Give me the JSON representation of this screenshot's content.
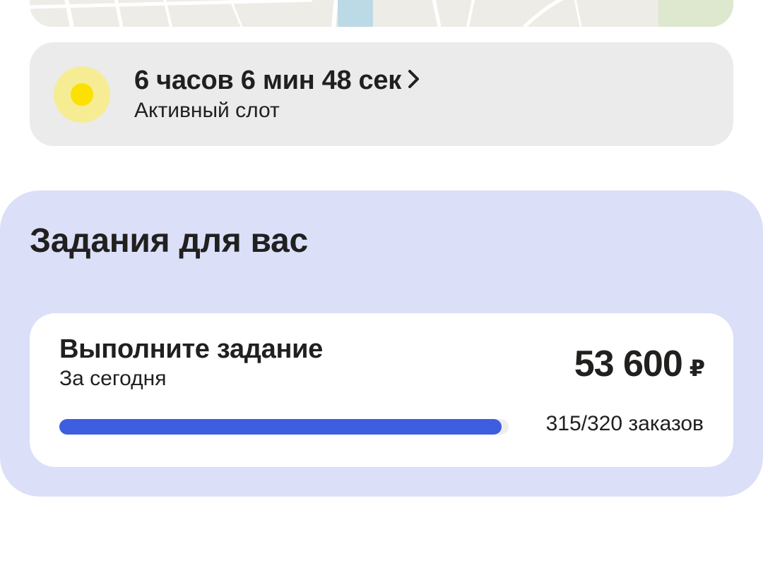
{
  "slot": {
    "time": "6 часов 6 мин 48 сек",
    "subtitle": "Активный слот",
    "icon": "chevron-right-icon",
    "dot_color": "#fce000"
  },
  "tasks": {
    "title": "Задания для вас",
    "card": {
      "title": "Выполните задание",
      "subtitle": "За сегодня",
      "reward_amount": "53 600",
      "reward_currency": "₽",
      "progress_text": "315/320 заказов",
      "progress_fraction": 0.984,
      "progress_color": "#3e5ee0"
    }
  }
}
